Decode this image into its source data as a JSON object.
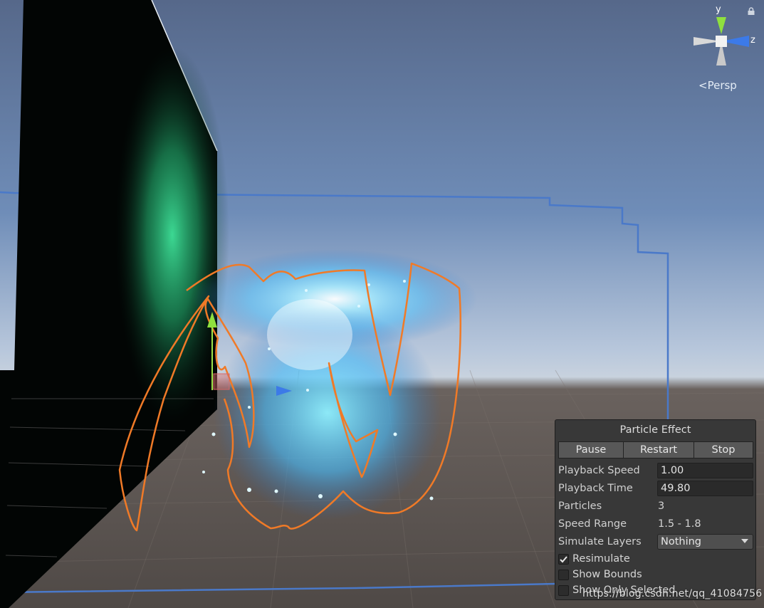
{
  "gizmo": {
    "x_axis": "",
    "y_axis": "y",
    "z_axis": "z",
    "projection": "Persp",
    "lock_icon": "lock-icon"
  },
  "colors": {
    "sky_top": "#5a6d8f",
    "ground": "#5b5450",
    "outline": "#f07a27",
    "particles": "#6fd8ff",
    "panel": "#383838"
  },
  "particle_panel": {
    "title": "Particle Effect",
    "buttons": {
      "pause": "Pause",
      "restart": "Restart",
      "stop": "Stop"
    },
    "playback_speed": {
      "label": "Playback Speed",
      "value": "1.00"
    },
    "playback_time": {
      "label": "Playback Time",
      "value": "49.80"
    },
    "particles": {
      "label": "Particles",
      "value": "3"
    },
    "speed_range": {
      "label": "Speed Range",
      "value": "1.5 - 1.8"
    },
    "simulate_layers": {
      "label": "Simulate Layers",
      "value": "Nothing"
    },
    "resimulate": {
      "label": "Resimulate",
      "checked": true
    },
    "show_bounds": {
      "label": "Show Bounds",
      "checked": false
    },
    "show_only_selected": {
      "label": "Show Only Selected",
      "checked": false
    }
  },
  "watermark": "https://blog.csdn.net/qq_41084756"
}
